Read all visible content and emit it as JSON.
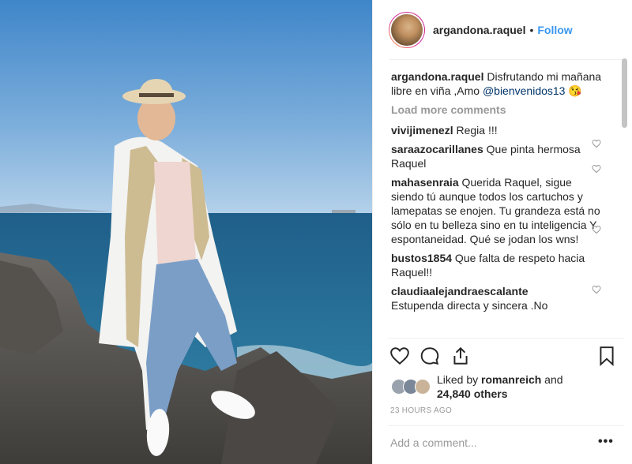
{
  "post": {
    "username": "argandona.raquel",
    "separator": "•",
    "follow_label": "Follow",
    "caption_user": "argandona.raquel",
    "caption_text_1": " Disfrutando mi mañana libre en viña ,Amo ",
    "caption_mention": "@bienvenidos13",
    "caption_emoji": "😘",
    "load_more": "Load more comments"
  },
  "comments": [
    {
      "user": "vivijimenezl",
      "text": " Regia !!!"
    },
    {
      "user": "saraazocarillanes",
      "text": " Que pinta hermosa Raquel"
    },
    {
      "user": "mahasenraia",
      "text": " Querida Raquel, sigue siendo tú aunque todos los cartuchos y lamepatas se enojen. Tu grandeza está no sólo en tu belleza sino en tu inteligencia Y espontaneidad. Qué se jodan los wns!"
    },
    {
      "user": "bustos1854",
      "text": " Que falta de respeto hacia Raquel!!"
    },
    {
      "user": "claudiaalejandraescalante",
      "text": "Estupenda directa y sincera .No"
    }
  ],
  "likes": {
    "prefix": "Liked by ",
    "user": "romanreich",
    "middle": " and",
    "count": "24,840 others"
  },
  "timestamp": "23 HOURS AGO",
  "add_comment_placeholder": "Add a comment...",
  "more_options": "•••",
  "icons": [
    "heart-icon",
    "comment-icon",
    "share-icon",
    "bookmark-icon",
    "more-icon"
  ],
  "colors": {
    "link": "#3897f0",
    "muted": "#999999",
    "text": "#262626"
  }
}
